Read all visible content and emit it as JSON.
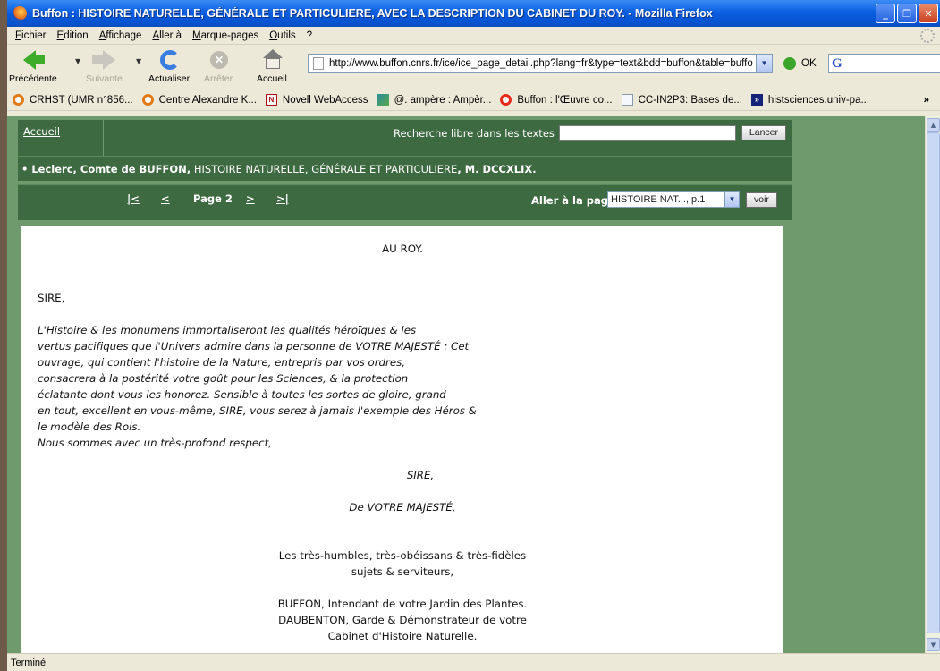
{
  "window": {
    "title": "Buffon : HISTOIRE NATURELLE, GÉNÉRALE ET PARTICULIERE, AVEC LA DESCRIPTION DU CABINET DU ROY. - Mozilla Firefox"
  },
  "menu": [
    "Fichier",
    "Edition",
    "Affichage",
    "Aller à",
    "Marque-pages",
    "Outils",
    "?"
  ],
  "toolbar": {
    "back": "Précédente",
    "forward": "Suivante",
    "reload": "Actualiser",
    "stop": "Arrêter",
    "home": "Accueil",
    "url": "http://www.buffon.cnrs.fr/ice/ice_page_detail.php?lang=fr&type=text&bdd=buffon&table=buffo",
    "go": "OK"
  },
  "bookmarks": [
    {
      "label": "CRHST (UMR n°856...",
      "icon": "ring-icon"
    },
    {
      "label": "Centre Alexandre K...",
      "icon": "ring-icon"
    },
    {
      "label": "Novell WebAccess",
      "icon": "novell-icon"
    },
    {
      "label": "@. ampère : Ampèr...",
      "icon": "image-icon"
    },
    {
      "label": "Buffon : l'Œuvre co...",
      "icon": "opera-icon"
    },
    {
      "label": "CC-IN2P3: Bases de...",
      "icon": "page-icon"
    },
    {
      "label": "histsciences.univ-pa...",
      "icon": "forward-icon"
    }
  ],
  "site": {
    "home_link": "Accueil",
    "search_label": "Recherche libre dans les textes",
    "search_value": "",
    "search_button": "Lancer",
    "breadcrumb_prefix": "• Leclerc, Comte de BUFFON,",
    "breadcrumb_link": "HISTOIRE NATURELLE, GÉNÉRALE ET PARTICULIERE",
    "breadcrumb_suffix": ", M. DCCXLIX.",
    "nav_first": "|<",
    "nav_prev": "<",
    "page_label": "Page 2",
    "nav_next": ">",
    "nav_last": ">|",
    "goto_label": "Aller à la page",
    "goto_selected": "HISTOIRE NAT..., p.1",
    "goto_button": "voir"
  },
  "document": {
    "heading": "AU ROY.",
    "salutation": "SIRE,",
    "body_lines": [
      "L'Histoire & les monumens immortaliseront les qualités héroïques & les",
      "vertus pacifiques que l'Univers admire dans la personne de VOTRE MAJESTÉ : Cet",
      "ouvrage, qui contient l'histoire de la Nature, entrepris par vos ordres,",
      "consacrera à la postérité votre goût pour les Sciences, & la protection",
      "éclatante dont vous les honorez. Sensible à toutes les sortes de gloire, grand",
      "en tout, excellent en vous-même, SIRE, vous serez à jamais l'exemple des Héros &",
      "le modèle des Rois.",
      "Nous sommes avec un très-profond respect,"
    ],
    "closing_sire": "SIRE,",
    "closing_majeste": "De VOTRE MAJESTÉ,",
    "signoff_1": "Les très-humbles, très-obéissans & très-fidèles",
    "signoff_2": "sujets & serviteurs,",
    "sig_1": "BUFFON, Intendant de votre Jardin des Plantes.",
    "sig_2": "DAUBENTON, Garde & Démonstrateur de votre",
    "sig_3": "Cabinet d'Histoire Naturelle."
  },
  "status": "Terminé"
}
